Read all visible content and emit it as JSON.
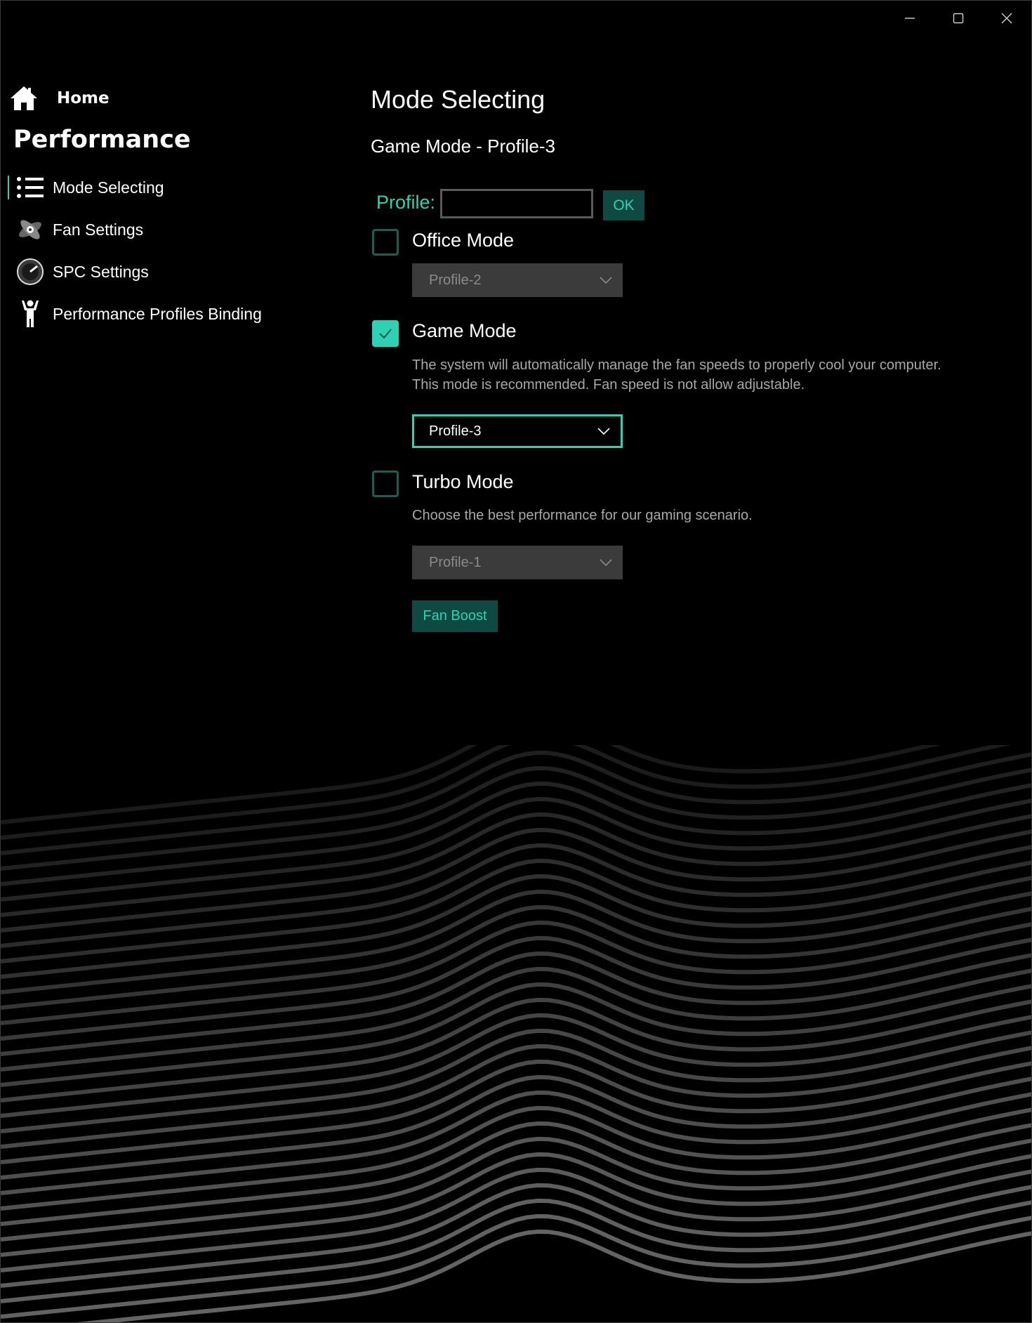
{
  "window": {
    "controls": [
      {
        "name": "minimize-icon"
      },
      {
        "name": "maximize-icon"
      },
      {
        "name": "close-icon"
      }
    ]
  },
  "sidebar": {
    "home_label": "Home",
    "section_title": "Performance",
    "items": [
      {
        "label": "Mode Selecting",
        "icon": "list-icon",
        "active": true
      },
      {
        "label": "Fan Settings",
        "icon": "fan-icon",
        "active": false
      },
      {
        "label": "SPC Settings",
        "icon": "gauge-icon",
        "active": false
      },
      {
        "label": "Performance Profiles Binding",
        "icon": "person-icon",
        "active": false
      }
    ]
  },
  "main": {
    "title": "Mode Selecting",
    "subtitle": "Game Mode - Profile-3",
    "profile_label": "Profile:",
    "profile_value": "",
    "ok_label": "OK",
    "modes": {
      "office": {
        "label": "Office Mode",
        "checked": false,
        "dropdown_value": "Profile-2"
      },
      "game": {
        "label": "Game Mode",
        "checked": true,
        "desc_line1": "The system will automatically manage the fan speeds to properly cool your computer.",
        "desc_line2": "This mode is recommended. Fan speed is not allow adjustable.",
        "dropdown_value": "Profile-3"
      },
      "turbo": {
        "label": "Turbo Mode",
        "checked": false,
        "desc": "Choose the best performance for our gaming scenario.",
        "dropdown_value": "Profile-1"
      }
    },
    "fan_boost_label": "Fan Boost"
  },
  "colors": {
    "accent": "#2fd1b5",
    "button_bg": "#0f4a42",
    "background": "#000000",
    "disabled_dropdown": "#3b3b3b"
  }
}
